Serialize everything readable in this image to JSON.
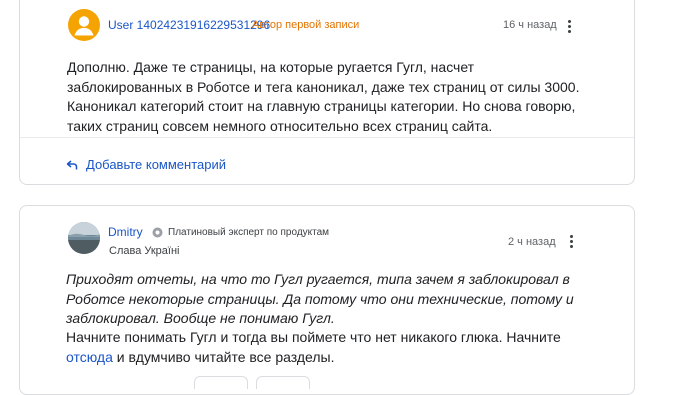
{
  "post1": {
    "username": "User 14024231916229531296",
    "author_badge": "Автор первой записи",
    "time": "16 ч назад",
    "avatar_icon": "user-icon",
    "body": "Дополню. Даже те страницы, на которые ругается Гугл, насчет заблокированных в Роботсе и тега каноникал, даже тех страниц от силы 3000. Каноникал категорий стоит на главную страницы категории. Но снова говорю, таких страниц совсем немного относительно всех страниц сайта.",
    "add_comment_label": "Добавьте комментарий",
    "reply_icon": "reply-arrow-icon"
  },
  "post2": {
    "username": "Dmitry",
    "expert_badge": "Платиновый эксперт по продуктам",
    "expert_icon": "platinum-badge-icon",
    "signature": "Слава Україні",
    "time": "2 ч назад",
    "quote": "Приходят отчеты, на что то Гугл ругается, типа зачем я заблокировал в Роботсе некоторые страницы. Да потому что они технические, потому и заблокировал. Вообще не понимаю Гугл.",
    "reply_before_link": "Начните понимать Гугл и тогда вы поймете что нет никакого глюка. Начните ",
    "link_text": "отсюда",
    "reply_after_link": " и вдумчиво читайте все разделы."
  },
  "colors": {
    "link": "#1a56c7",
    "author_badge": "#e37400",
    "avatar_user": "#f4a300",
    "border": "#dadce0"
  }
}
